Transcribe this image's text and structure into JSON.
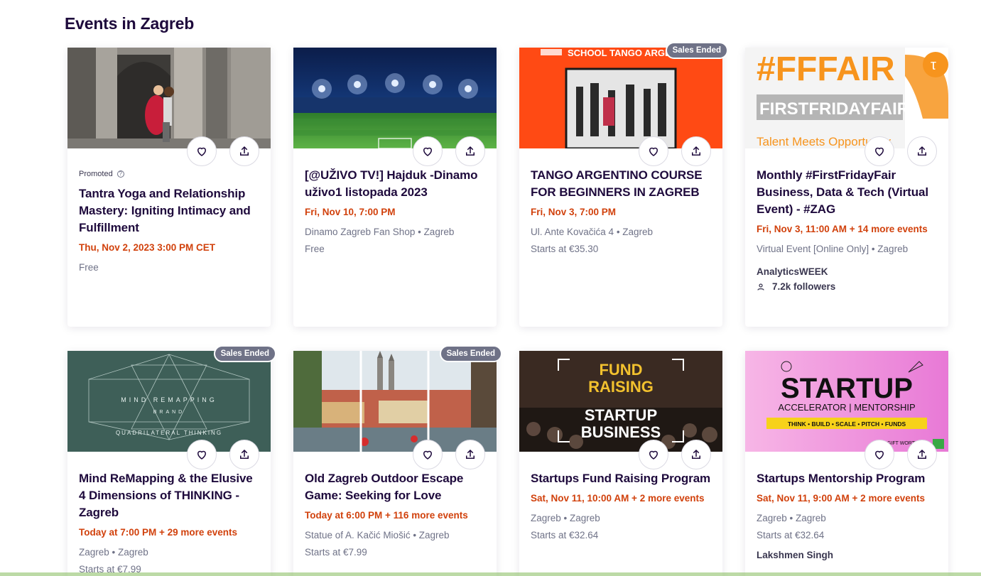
{
  "section_title": "Events in Zagreb",
  "sales_ended_label": "Sales Ended",
  "promoted_label": "Promoted",
  "cards": [
    {
      "title": "Tantra Yoga and Relationship Mastery: Igniting Intimacy and Fulfillment",
      "date": "Thu, Nov 2, 2023 3:00 PM CET",
      "location": "",
      "price": "Free",
      "promoted": true
    },
    {
      "title": "[@UŽIVO TV!] Hajduk -Dinamo uživo1 listopada 2023",
      "date": "Fri, Nov 10, 7:00 PM",
      "location": "Dinamo Zagreb Fan Shop • Zagreb",
      "price": "Free"
    },
    {
      "title": "TANGO ARGENTINO COURSE FOR BEGINNERS IN ZAGREB",
      "date": "Fri, Nov 3, 7:00 PM",
      "location": "Ul. Ante Kovačića 4 • Zagreb",
      "price": "Starts at €35.30",
      "image_text": "SCHOOL TANGO ARGE"
    },
    {
      "title": "Monthly #FirstFridayFair Business, Data & Tech (Virtual Event) - #ZAG",
      "date": "Fri, Nov 3, 11:00 AM + 14 more events",
      "location": "Virtual Event [Online Only] • Zagreb",
      "price": "",
      "organizer": "AnalyticsWEEK",
      "followers": "7.2k followers",
      "image_text": {
        "line1": "#FFFAIR",
        "line2": "FIRSTFRIDAYFAIR",
        "line3": "Talent Meets Opportunity",
        "logo": "τ"
      }
    },
    {
      "title": "Mind ReMapping & the Elusive 4 Dimensions of THINKING - Zagreb",
      "date": "Today at 7:00 PM + 29 more events",
      "location": "Zagreb • Zagreb",
      "price": "Starts at €7.99",
      "image_text": {
        "line1": "MIND REMAPPING",
        "line2": "BRAND",
        "line3": "QUADRILATERAL THINKING"
      }
    },
    {
      "title": "Old Zagreb Outdoor Escape Game: Seeking for Love",
      "date": "Today at 6:00 PM + 116 more events",
      "location": "Statue of A. Kačić Miošić • Zagreb",
      "price": "Starts at €7.99"
    },
    {
      "title": "Startups Fund Raising Program",
      "date": "Sat, Nov 11, 10:00 AM + 2 more events",
      "location": "Zagreb • Zagreb",
      "price": "Starts at €32.64",
      "image_text": {
        "line1": "FUND",
        "line2": "RAISING",
        "line3": "STARTUP",
        "line4": "BUSINESS"
      }
    },
    {
      "title": "Startups Mentorship Program",
      "date": "Sat, Nov 11, 9:00 AM + 2 more events",
      "location": "Zagreb • Zagreb",
      "price": "Starts at €32.64",
      "organizer": "Lakshmen Singh",
      "image_text": {
        "line1": "STARTUP",
        "line2": "ACCELERATOR | MENTORSHIP",
        "line3": "THINK • BUILD • SCALE • PITCH • FUNDS",
        "line4": "GIFT WORTH"
      }
    }
  ]
}
